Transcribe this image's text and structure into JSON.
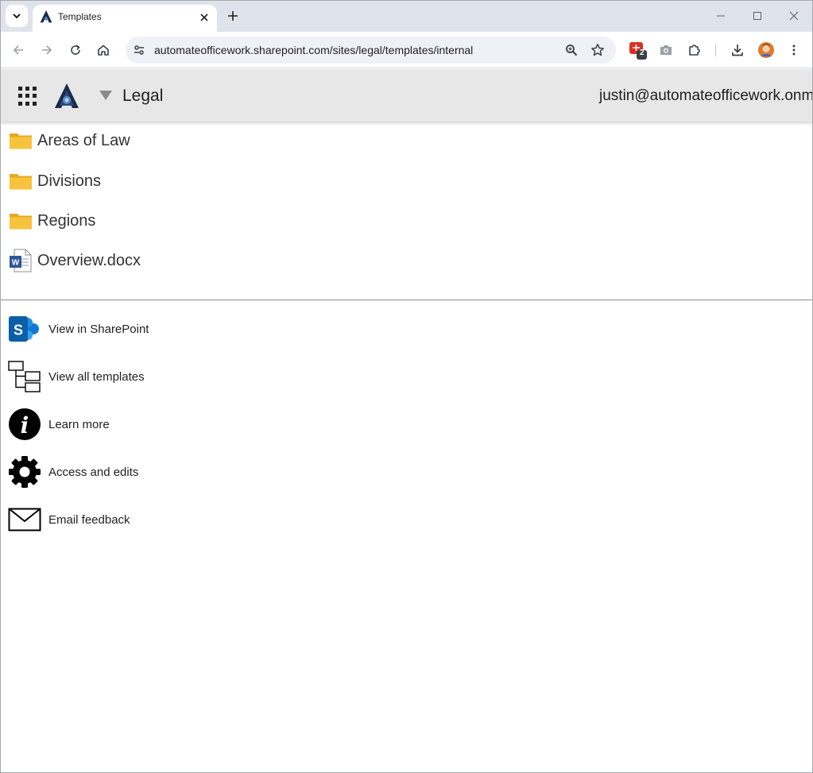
{
  "browser": {
    "tab_title": "Templates",
    "url": "automateofficework.sharepoint.com/sites/legal/templates/internal",
    "extension_badge": "2"
  },
  "header": {
    "site_name": "Legal",
    "user_email": "justin@automateofficework.onmicr"
  },
  "files": [
    {
      "label": "Areas of Law",
      "type": "folder"
    },
    {
      "label": "Divisions",
      "type": "folder"
    },
    {
      "label": "Regions",
      "type": "folder"
    },
    {
      "label": "Overview.docx",
      "type": "word-document"
    }
  ],
  "actions": [
    {
      "label": "View in SharePoint",
      "icon": "sharepoint-icon"
    },
    {
      "label": "View all templates",
      "icon": "tree-icon"
    },
    {
      "label": "Learn more",
      "icon": "info-icon"
    },
    {
      "label": "Access and edits",
      "icon": "gear-icon"
    },
    {
      "label": "Email feedback",
      "icon": "envelope-icon"
    }
  ],
  "colors": {
    "folder": "#f8c33c",
    "sharepoint": "#0f78d4",
    "word": "#2b579a",
    "header_bg": "#e7e7e7"
  }
}
